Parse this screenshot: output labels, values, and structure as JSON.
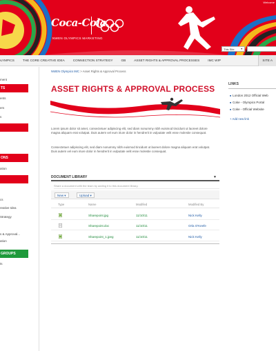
{
  "banner": {
    "welcome": "Welcome",
    "brand": "Coca-Cola",
    "subtitle": "NWEN OLYMPICS MARKETING"
  },
  "site_search": {
    "scope": "This Site"
  },
  "topnav": {
    "items": [
      "OLYMPICS",
      "THE CORE CREATIVE IDEA",
      "CONNECTION STRATEGY",
      "GB",
      "ASSET RIGHTS & APPROVAL PROCESSES",
      "IMC WIP",
      "SITE A"
    ]
  },
  "leftnav": {
    "links": [
      "ment",
      "ents",
      "ers",
      "s",
      "ation",
      "cs",
      "reative Idea",
      "Strategy",
      "s & Approval...",
      "ation",
      "ts"
    ],
    "headers": [
      "TS",
      "",
      "ONS",
      "",
      "GROUPS"
    ]
  },
  "breadcrumb": {
    "home": "NWEN Olympics IMC",
    "separator": ">",
    "current": "Asset Rights & Approval Process"
  },
  "page": {
    "title": "ASSET RIGHTS & APPROVAL PROCESS",
    "para1": "Lorem ipsum dolor sit amet, consectetuer adipiscing elit, sed diam nonummy nibh euismod tincidunt ut laoreet dolore magna aliquam erat volutpat. Duis autem vel eum iriure dolor in hendrerit in vulputate velit esse molestie consequat.",
    "para2": "Consectetuer adipiscing elit, sed diam nonummy nibh euismod tincidunt ut laoreet dolore magna aliquam erat volutpat. Duis autem vel eum iriure dolor in hendrerit in vulputate velit esse molestie consequat."
  },
  "doclib": {
    "title": "DOCUMENT LIBRARY",
    "share_hint": "Share a document with the team by adding it to this document library.",
    "new_label": "New",
    "upload_label": "Upload",
    "columns": [
      "Type",
      "Name",
      "Modified",
      "Modified By"
    ],
    "rows": [
      {
        "type": "image-file-icon",
        "name": "Sharepoint.jpg",
        "modified": "11/10/11",
        "modified_by": "Nick Kelly"
      },
      {
        "type": "doc-file-icon",
        "name": "Sharepoint.doc",
        "modified": "11/10/11",
        "modified_by": "Orla O'Keefe"
      },
      {
        "type": "image-file-icon",
        "name": "Sharepoint_1.jpeg",
        "modified": "11/10/11",
        "modified_by": "Nick Kelly"
      }
    ]
  },
  "links": {
    "title": "LINKS",
    "items": [
      "London 2012 Official Web",
      "Coke - Olympics Portal",
      "Coke - Official Website"
    ],
    "add_label": "Add new link"
  },
  "colors": {
    "brand_red": "#e2001a",
    "accent_green": "#1e9a3b",
    "link_blue": "#1f5ba6"
  }
}
